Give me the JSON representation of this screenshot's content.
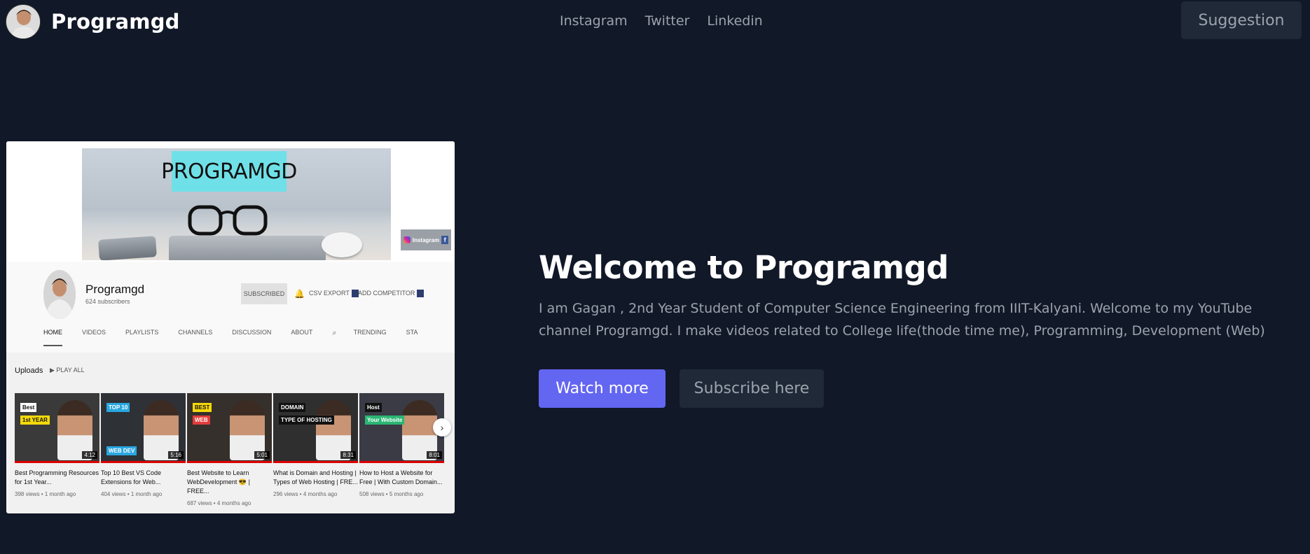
{
  "header": {
    "brand_name": "Programgd",
    "nav": [
      "Instagram",
      "Twitter",
      "Linkedin"
    ],
    "suggestion_label": "Suggestion"
  },
  "hero": {
    "title": "Welcome to Programgd",
    "description": "I am Gagan , 2nd Year Student of Computer Science Engineering from IIIT-Kalyani. Welcome to my YouTube channel Programgd. I make videos related to College life(thode time me), Programming, Development (Web)",
    "watch_label": "Watch more",
    "subscribe_label": "Subscribe here"
  },
  "channel_screenshot": {
    "banner_text": "PROGRAMGD",
    "social_label": "Instagram",
    "channel_name": "Programgd",
    "subscribers": "624 subscribers",
    "subscribed_label": "SUBSCRIBED",
    "csv_export": "CSV EXPORT",
    "add_competitor": "ADD COMPETITOR",
    "tabs": [
      "HOME",
      "VIDEOS",
      "PLAYLISTS",
      "CHANNELS",
      "DISCUSSION",
      "ABOUT",
      "TRENDING",
      "STA"
    ],
    "uploads_label": "Uploads",
    "play_all_label": "PLAY ALL",
    "videos": [
      {
        "label1": "Best",
        "label2": "1st YEAR",
        "duration": "4:12",
        "title": "Best Programming Resources for 1st Year...",
        "meta": "398 views • 1 month ago"
      },
      {
        "label1": "TOP 10",
        "label2": "WEB DEV",
        "duration": "5:16",
        "title": "Top 10 Best VS Code Extensions for Web...",
        "meta": "404 views • 1 month ago"
      },
      {
        "label1": "BEST",
        "label2": "WEB",
        "duration": "5:01",
        "title": "Best Website to Learn WebDevelopment 😎 | FREE...",
        "meta": "687 views • 4 months ago"
      },
      {
        "label1": "DOMAIN",
        "label2": "TYPE OF HOSTING",
        "duration": "8:31",
        "title": "What is Domain and Hosting | Types of Web Hosting | FRE...",
        "meta": "296 views • 4 months ago"
      },
      {
        "label1": "Host",
        "label2": "Your Website",
        "duration": "8:01",
        "title": "How to Host a Website for Free | With Custom Domain...",
        "meta": "508 views • 5 months ago"
      }
    ],
    "colors": {
      "banner_tag": "#6fe0e8",
      "progress": "#dd0000"
    }
  },
  "colors": {
    "bg": "#111827",
    "accent": "#6366f1",
    "muted": "#9ca3af",
    "button_dark": "#1f2937"
  }
}
